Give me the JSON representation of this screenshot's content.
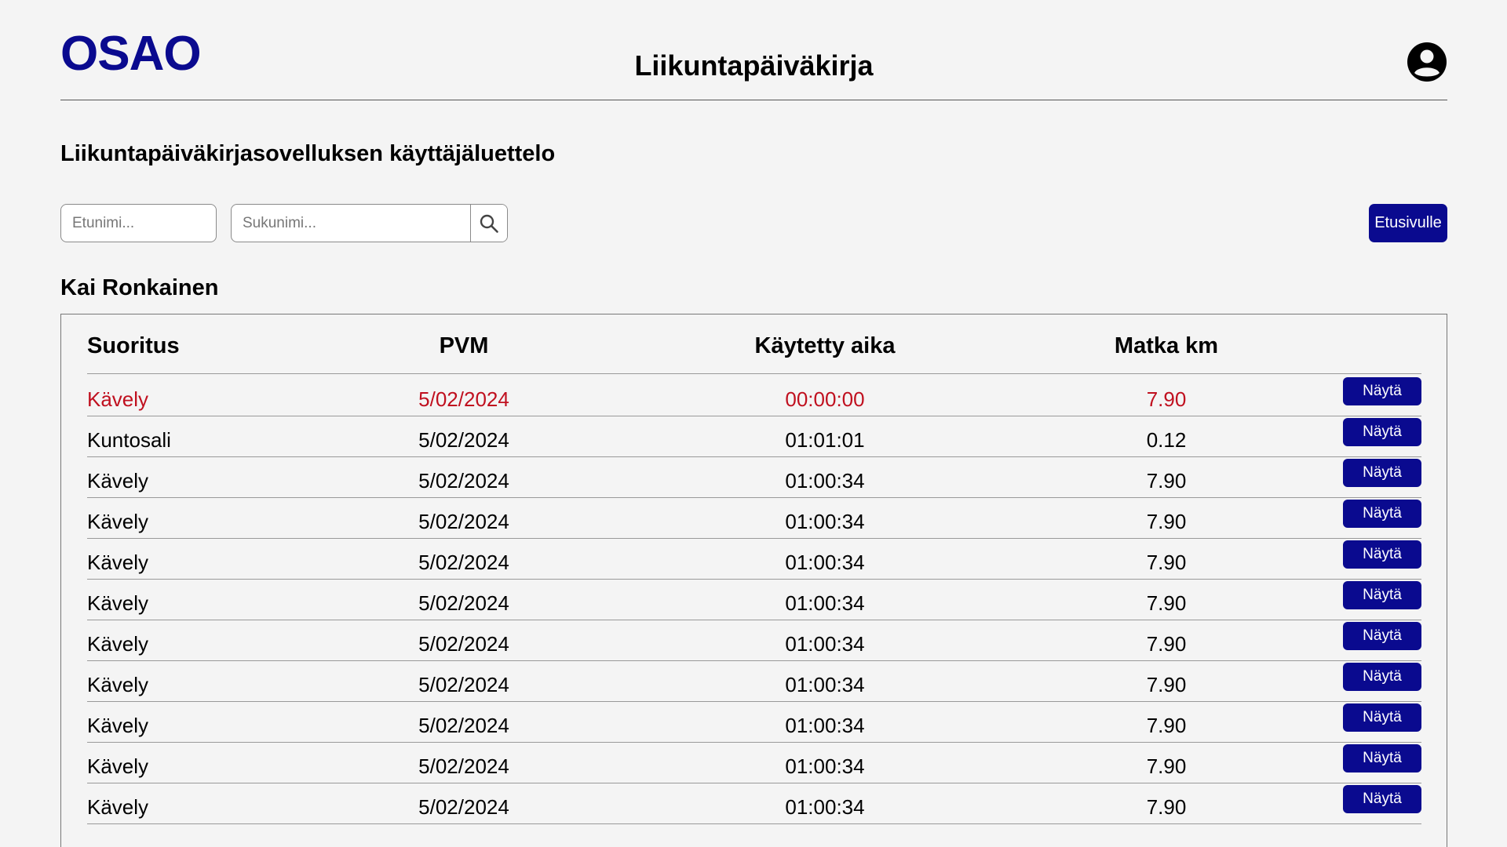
{
  "header": {
    "logo": "OSAO",
    "title": "Liikuntapäiväkirja",
    "user_icon": "account-circle-icon"
  },
  "page_heading": "Liikuntapäiväkirjasovelluksen käyttäjäluettelo",
  "search": {
    "first_name_placeholder": "Etunimi...",
    "first_name_value": "",
    "last_name_placeholder": "Sukunimi...",
    "last_name_value": "",
    "search_icon": "search-icon"
  },
  "home_button": "Etusivulle",
  "user_name": "Kai Ronkainen",
  "colors": {
    "brand": "#0a0a8f",
    "highlight": "#c0101f"
  },
  "table": {
    "columns": [
      "Suoritus",
      "PVM",
      "Käytetty aika",
      "Matka km"
    ],
    "view_label": "Näytä",
    "rows": [
      {
        "activity": "Kävely",
        "date": "5/02/2024",
        "time": "00:00:00",
        "distance": "7.90",
        "highlight": true
      },
      {
        "activity": "Kuntosali",
        "date": "5/02/2024",
        "time": "01:01:01",
        "distance": "0.12",
        "highlight": false
      },
      {
        "activity": "Kävely",
        "date": "5/02/2024",
        "time": "01:00:34",
        "distance": "7.90",
        "highlight": false
      },
      {
        "activity": "Kävely",
        "date": "5/02/2024",
        "time": "01:00:34",
        "distance": "7.90",
        "highlight": false
      },
      {
        "activity": "Kävely",
        "date": "5/02/2024",
        "time": "01:00:34",
        "distance": "7.90",
        "highlight": false
      },
      {
        "activity": "Kävely",
        "date": "5/02/2024",
        "time": "01:00:34",
        "distance": "7.90",
        "highlight": false
      },
      {
        "activity": "Kävely",
        "date": "5/02/2024",
        "time": "01:00:34",
        "distance": "7.90",
        "highlight": false
      },
      {
        "activity": "Kävely",
        "date": "5/02/2024",
        "time": "01:00:34",
        "distance": "7.90",
        "highlight": false
      },
      {
        "activity": "Kävely",
        "date": "5/02/2024",
        "time": "01:00:34",
        "distance": "7.90",
        "highlight": false
      },
      {
        "activity": "Kävely",
        "date": "5/02/2024",
        "time": "01:00:34",
        "distance": "7.90",
        "highlight": false
      },
      {
        "activity": "Kävely",
        "date": "5/02/2024",
        "time": "01:00:34",
        "distance": "7.90",
        "highlight": false
      }
    ]
  }
}
